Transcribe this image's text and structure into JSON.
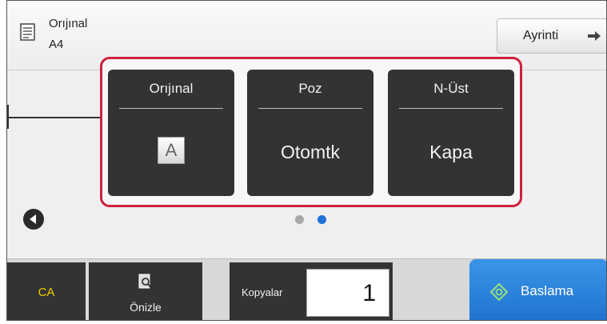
{
  "header": {
    "original_label": "Orıjınal",
    "paper_size": "A4",
    "detail_button": "Ayrinti"
  },
  "settings": [
    {
      "title": "Orıjınal",
      "value": "A"
    },
    {
      "title": "Poz",
      "value": "Otomtk"
    },
    {
      "title": "N-Üst",
      "value": "Kapa"
    }
  ],
  "pagination": {
    "pages": 2,
    "current": 2
  },
  "footer": {
    "ca_label": "CA",
    "preview_label": "Önizle",
    "copies_label": "Kopyalar",
    "copies_value": "1",
    "start_label": "Baslama"
  },
  "colors": {
    "highlight": "#d0203c",
    "accent": "#1f73d6",
    "ca_text": "#f0d000"
  }
}
